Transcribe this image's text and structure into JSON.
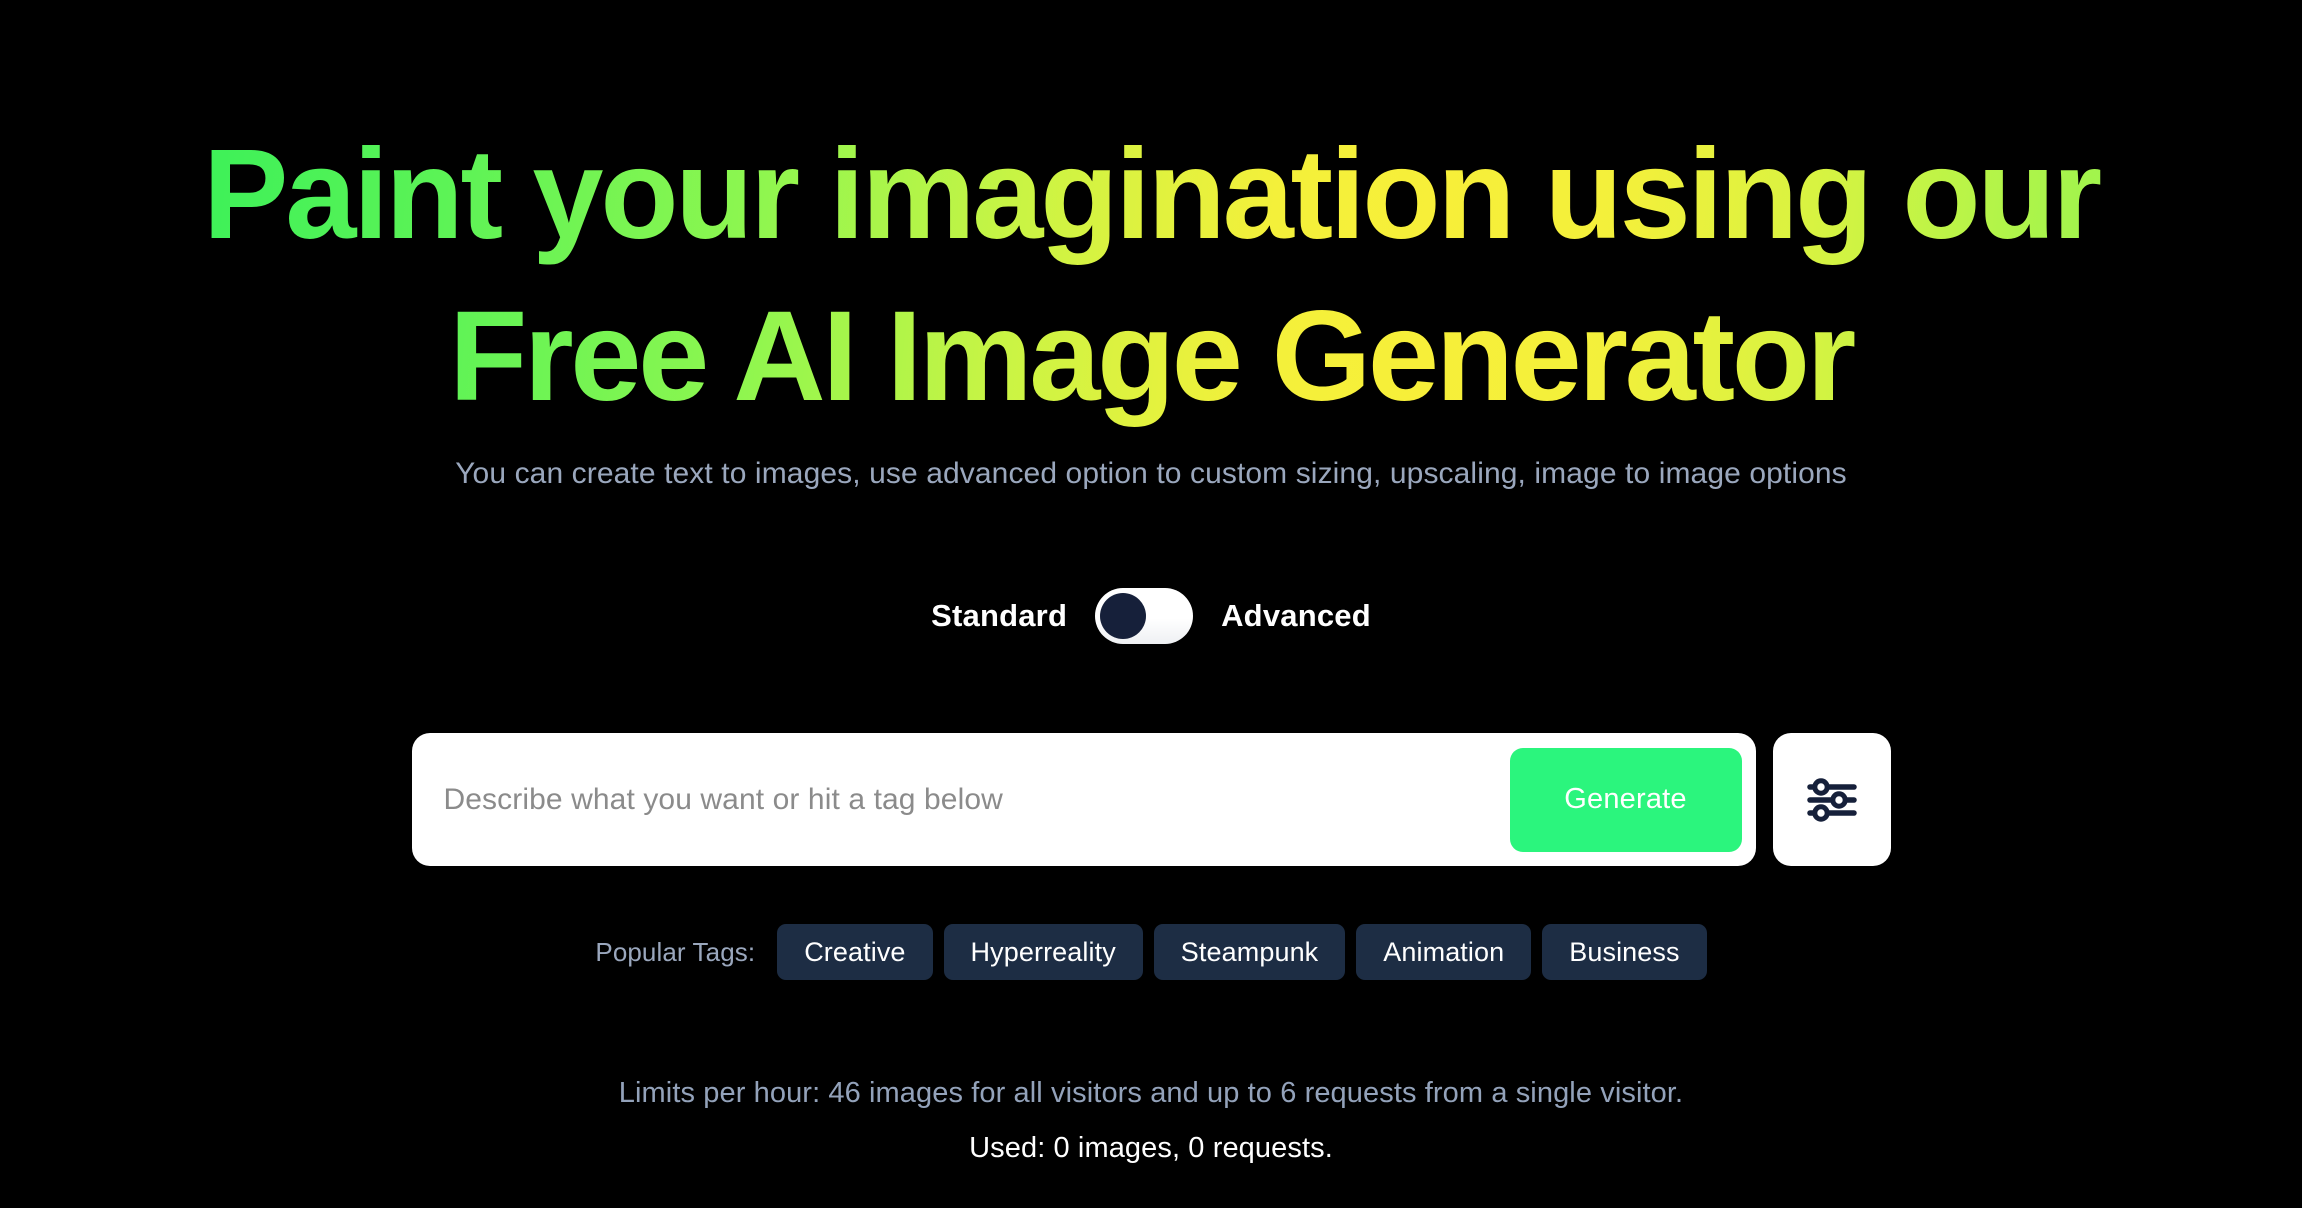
{
  "theme": {
    "background": "#000000",
    "heading_gradient_start": "#35f059",
    "heading_gradient_mid": "#f7ef39",
    "heading_gradient_end": "#7ef655",
    "accent_green": "#2bf57d",
    "muted_text": "#9aa7bd",
    "chip_background": "#1d2d44",
    "toggle_knob": "#16203a"
  },
  "hero": {
    "heading_line_1": "Paint your imagination using our",
    "heading_line_2": "Free AI Image Generator",
    "subtitle": "You can create text to images, use advanced option to custom sizing, upscaling, image to image options"
  },
  "mode_toggle": {
    "left_label": "Standard",
    "right_label": "Advanced",
    "selected": "Standard",
    "knob_position": "left"
  },
  "prompt": {
    "placeholder": "Describe what you want or hit a tag below",
    "value": "",
    "generate_label": "Generate",
    "settings_icon": "sliders-icon"
  },
  "tags": {
    "label": "Popular Tags:",
    "items": [
      {
        "label": "Creative"
      },
      {
        "label": "Hyperreality"
      },
      {
        "label": "Steampunk"
      },
      {
        "label": "Animation"
      },
      {
        "label": "Business"
      }
    ]
  },
  "limits": {
    "limits_text": "Limits per hour: 46 images for all visitors and up to 6 requests from a single visitor.",
    "used_text": "Used: 0 images, 0 requests.",
    "images_per_hour": 46,
    "requests_per_visitor": 6,
    "used_images": 0,
    "used_requests": 0
  }
}
